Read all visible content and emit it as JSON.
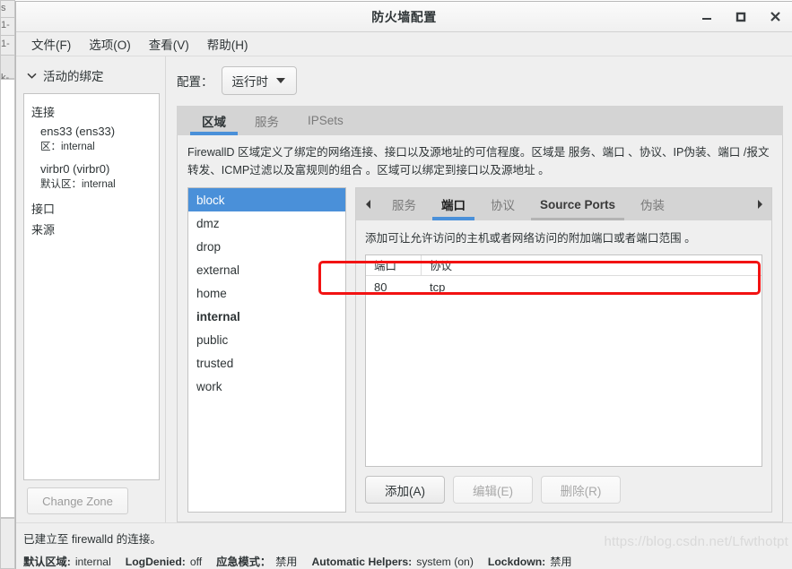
{
  "window": {
    "title": "防火墙配置",
    "controls": {
      "minimize": "minimize-icon",
      "maximize": "maximize-icon",
      "close": "close-icon"
    }
  },
  "menubar": {
    "items": [
      {
        "label": "文件(F)"
      },
      {
        "label": "选项(O)"
      },
      {
        "label": "查看(V)"
      },
      {
        "label": "帮助(H)"
      }
    ]
  },
  "background_fragments": {
    "f1": "s",
    "f2": "1-",
    "f3": "1-",
    "f4": "k-"
  },
  "sidebar": {
    "bindings_header": "活动的绑定",
    "groups": [
      {
        "label": "连接"
      },
      {
        "label": "接口"
      },
      {
        "label": "来源"
      }
    ],
    "connections": [
      {
        "name": "ens33 (ens33)",
        "zone_label": "区",
        "zone_sep": "：",
        "zone_value": "internal"
      },
      {
        "name": "virbr0 (virbr0)",
        "zone_label": "默认区",
        "zone_sep": "：",
        "zone_value": "internal"
      }
    ],
    "change_zone_label": "Change Zone"
  },
  "main": {
    "config_label": "配置：",
    "config_value": "运行时",
    "tabs": [
      {
        "label": "区域",
        "active": true
      },
      {
        "label": "服务",
        "active": false
      },
      {
        "label": "IPSets",
        "active": false
      }
    ],
    "zone_description": "FirewallD 区域定义了绑定的网络连接、接口以及源地址的可信程度。区域是 服务、端口 、协议、IP伪装、端口 /报文转发、ICMP过滤以及富规则的组合 。区域可以绑定到接口以及源地址 。",
    "zones": [
      {
        "name": "block",
        "selected": true,
        "default": false
      },
      {
        "name": "dmz",
        "selected": false,
        "default": false
      },
      {
        "name": "drop",
        "selected": false,
        "default": false
      },
      {
        "name": "external",
        "selected": false,
        "default": false
      },
      {
        "name": "home",
        "selected": false,
        "default": false
      },
      {
        "name": "internal",
        "selected": false,
        "default": true
      },
      {
        "name": "public",
        "selected": false,
        "default": false
      },
      {
        "name": "trusted",
        "selected": false,
        "default": false
      },
      {
        "name": "work",
        "selected": false,
        "default": false
      }
    ],
    "sub_tabs": {
      "scroll_left": "chevron-left-icon",
      "scroll_right": "chevron-right-icon",
      "items": [
        {
          "label": "服务",
          "state": "normal"
        },
        {
          "label": "端口",
          "state": "active"
        },
        {
          "label": "协议",
          "state": "normal"
        },
        {
          "label": "Source Ports",
          "state": "hover"
        },
        {
          "label": "伪装",
          "state": "normal"
        }
      ]
    },
    "ports_panel": {
      "description": "添加可让允许访问的主机或者网络访问的附加端口或者端口范围 。",
      "columns": [
        "端口",
        "协议"
      ],
      "rows": [
        {
          "port": "80",
          "protocol": "tcp"
        }
      ],
      "buttons": [
        {
          "label": "添加(A)",
          "enabled": true
        },
        {
          "label": "编辑(E)",
          "enabled": false
        },
        {
          "label": "删除(R)",
          "enabled": false
        }
      ]
    }
  },
  "statusbar": {
    "connection_message": "已建立至  firewalld 的连接。",
    "fields": [
      {
        "key": "默认区域:",
        "value": "internal"
      },
      {
        "key": "LogDenied:",
        "value": "off"
      },
      {
        "key": "应急模式：",
        "value": "禁用"
      },
      {
        "key": "Automatic Helpers:",
        "value": "system (on)"
      },
      {
        "key": "Lockdown:",
        "value": "禁用"
      }
    ]
  },
  "watermark": "https://blog.csdn.net/Lfwthotpt",
  "colors": {
    "accent": "#4a90d9",
    "annotation": "#f21212",
    "window_bg": "#efefef",
    "tabstrip_bg": "#d4d4d4"
  }
}
